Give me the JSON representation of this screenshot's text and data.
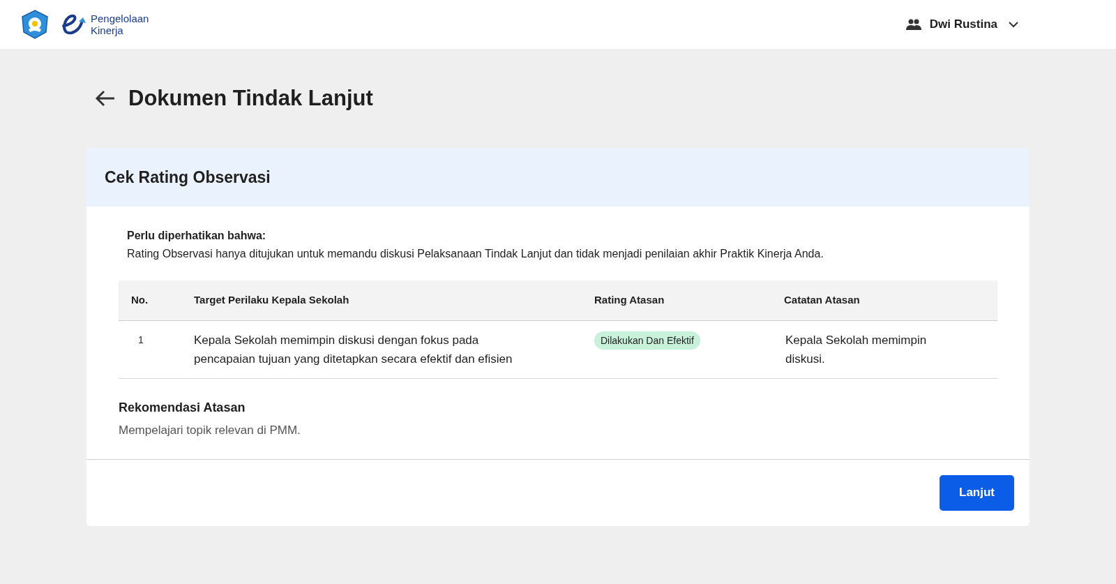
{
  "header": {
    "brand": [
      "Pengelolaan",
      "Kinerja"
    ],
    "user": "Dwi Rustina"
  },
  "page": {
    "title": "Dokumen Tindak Lanjut"
  },
  "card": {
    "title": "Cek Rating Observasi",
    "note": {
      "heading": "Perlu diperhatikan bahwa:",
      "text": "Rating Observasi hanya ditujukan untuk memandu diskusi Pelaksanaan Tindak Lanjut dan tidak menjadi penilaian akhir Praktik Kinerja Anda."
    },
    "table": {
      "columns": [
        "No.",
        "Target Perilaku Kepala Sekolah",
        "Rating Atasan",
        "Catatan Atasan"
      ],
      "rows": [
        {
          "no": "1",
          "target": "Kepala Sekolah memimpin diskusi dengan fokus pada pencapaian tujuan yang ditetapkan secara efektif dan efisien",
          "rating": {
            "label": "Dilakukan Dan Efektif",
            "color": "#c8f1d9"
          },
          "note": "Kepala Sekolah memimpin diskusi."
        }
      ]
    },
    "recommendation": {
      "heading": "Rekomendasi Atasan",
      "text": "Mempelajari topik relevan di PMM."
    },
    "button": "Lanjut"
  }
}
